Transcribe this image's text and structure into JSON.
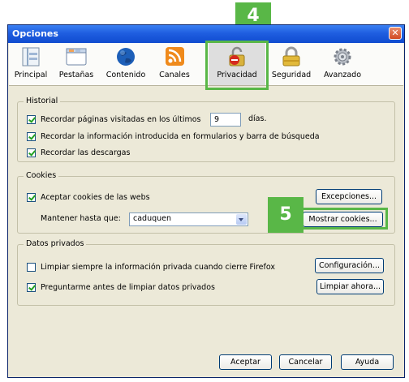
{
  "window": {
    "title": "Opciones"
  },
  "toolbar": [
    {
      "label": "Principal",
      "icon": "main-panel-icon"
    },
    {
      "label": "Pestañas",
      "icon": "tabs-window-icon"
    },
    {
      "label": "Contenido",
      "icon": "globe-icon"
    },
    {
      "label": "Canales",
      "icon": "rss-feed-icon"
    },
    {
      "label": "Privacidad",
      "icon": "privacy-lock-icon",
      "selected": true
    },
    {
      "label": "Seguridad",
      "icon": "security-padlock-icon"
    },
    {
      "label": "Avanzado",
      "icon": "gear-icon"
    }
  ],
  "historial": {
    "legend": "Historial",
    "remember_pages_before": "Recordar páginas visitadas en los últimos",
    "days_value": "9",
    "days_after": "días.",
    "remember_forms": "Recordar la información introducida en formularios y barra de búsqueda",
    "remember_downloads": "Recordar las descargas"
  },
  "cookies": {
    "legend": "Cookies",
    "accept": "Aceptar cookies de las webs",
    "exceptions_button": "Excepciones...",
    "keep_label": "Mantener hasta que:",
    "keep_value": "caduquen",
    "show_button": "Mostrar cookies..."
  },
  "privados": {
    "legend": "Datos privados",
    "always_clear": "Limpiar siempre la información privada cuando cierre Firefox",
    "config_button": "Configuración...",
    "ask_before": "Preguntarme antes de limpiar datos privados",
    "clear_now_button": "Limpiar ahora..."
  },
  "footer": {
    "accept": "Aceptar",
    "cancel": "Cancelar",
    "help": "Ayuda"
  },
  "annotations": {
    "step4": "4",
    "step5": "5",
    "color": "#59b747"
  }
}
